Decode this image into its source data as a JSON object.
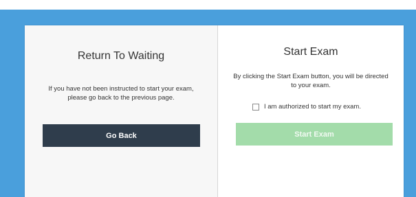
{
  "return_panel": {
    "title": "Return To Waiting",
    "description": "If you have not been instructed to start your exam, please go back to the previous page.",
    "button_label": "Go Back"
  },
  "start_panel": {
    "title": "Start Exam",
    "description": "By clicking the Start Exam button, you will be directed to your exam.",
    "authorization_label": "I am authorized to start my exam.",
    "authorization_checked": false,
    "button_label": "Start Exam",
    "button_enabled": false
  },
  "colors": {
    "background": "#4a9fdc",
    "go_back_button": "#2f3d4c",
    "start_exam_button_disabled": "#a3dcaa"
  }
}
